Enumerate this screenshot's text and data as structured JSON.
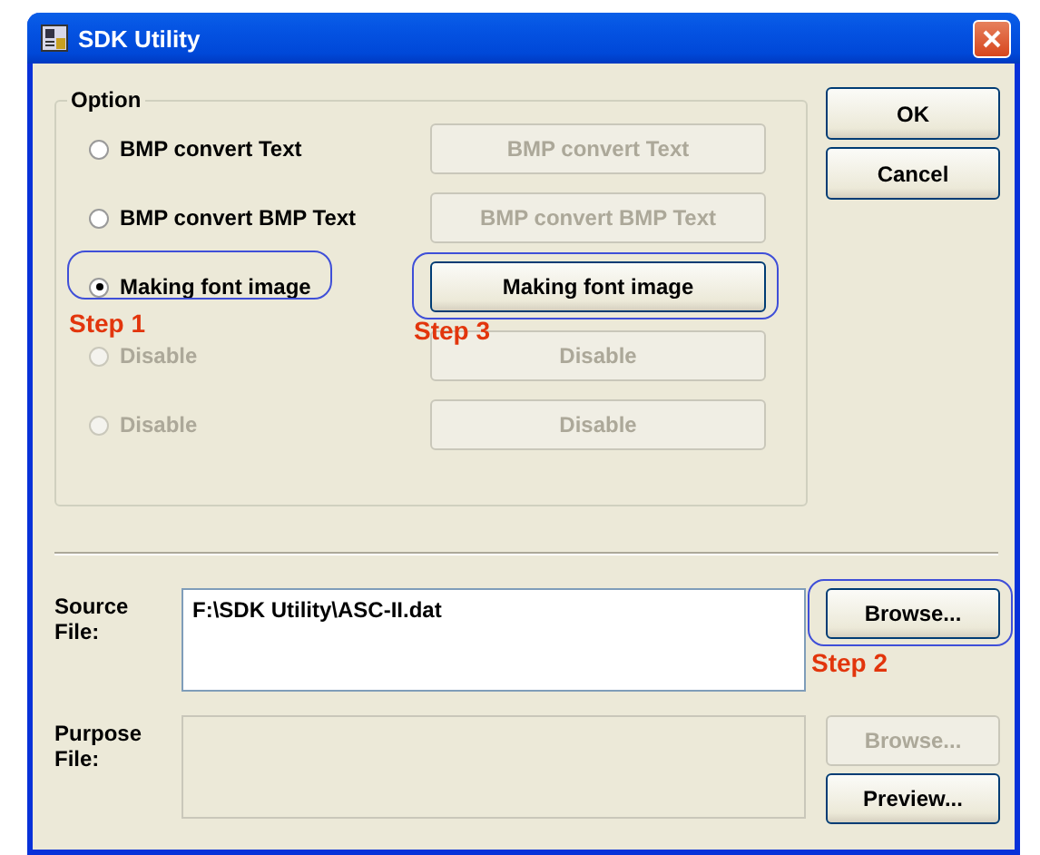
{
  "window": {
    "title": "SDK Utility"
  },
  "option_group": {
    "title": "Option",
    "options": [
      {
        "radio": {
          "label": "BMP convert Text",
          "selected": false,
          "disabled": false,
          "circled": false
        },
        "button": {
          "label": "BMP convert Text",
          "disabled": true,
          "circled": false
        }
      },
      {
        "radio": {
          "label": "BMP convert BMP Text",
          "selected": false,
          "disabled": false,
          "circled": false
        },
        "button": {
          "label": "BMP convert BMP Text",
          "disabled": true,
          "circled": false
        }
      },
      {
        "radio": {
          "label": "Making font image",
          "selected": true,
          "disabled": false,
          "circled": true,
          "step": "Step 1"
        },
        "button": {
          "label": "Making font image",
          "disabled": false,
          "circled": true,
          "step": "Step 3"
        }
      },
      {
        "radio": {
          "label": "Disable",
          "selected": false,
          "disabled": true,
          "circled": false
        },
        "button": {
          "label": "Disable",
          "disabled": true,
          "circled": false
        }
      },
      {
        "radio": {
          "label": "Disable",
          "selected": false,
          "disabled": true,
          "circled": false
        },
        "button": {
          "label": "Disable",
          "disabled": true,
          "circled": false
        }
      }
    ]
  },
  "side_buttons": [
    {
      "label": "OK",
      "disabled": false
    },
    {
      "label": "Cancel",
      "disabled": false
    }
  ],
  "source_file": {
    "label": "Source File:",
    "value": "F:\\SDK Utility\\ASC-II.dat",
    "disabled": false,
    "buttons": [
      {
        "label": "Browse...",
        "disabled": false,
        "circled": true,
        "step": "Step 2"
      }
    ]
  },
  "purpose_file": {
    "label": "Purpose File:",
    "disabled": true,
    "buttons": [
      {
        "label": "Browse...",
        "disabled": true,
        "circled": false
      },
      {
        "label": "Preview...",
        "disabled": false,
        "circled": false
      }
    ]
  }
}
